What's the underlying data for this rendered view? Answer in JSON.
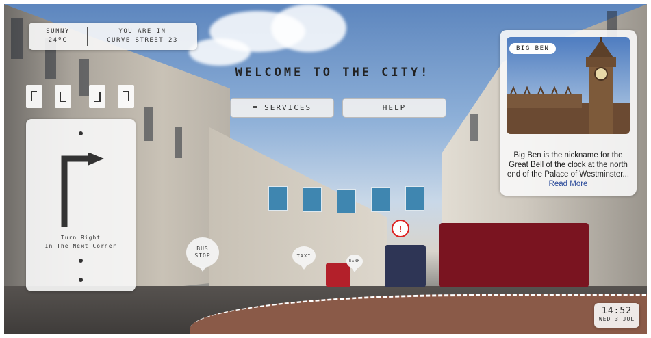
{
  "weather": {
    "condition": "SUNNY",
    "temperature": "24ºC"
  },
  "location": {
    "line1": "YOU ARE IN",
    "line2": "CURVE STREET 23"
  },
  "welcome_title": "WELCOME TO THE CITY!",
  "menu": {
    "services_icon": "≡",
    "services_label": "SERVICES",
    "help_label": "HELP"
  },
  "navigation": {
    "line1": "Turn Right",
    "line2": "In The Next Corner",
    "arrow_icon": "turn-right-arrow-icon"
  },
  "info_card": {
    "tag": "BIG BEN",
    "description": "Big Ben is the nickname for the Great Bell of the clock at the north end of the Palace of Westminster...",
    "read_more": "Read More"
  },
  "map_pins": {
    "bus_line1": "BUS",
    "bus_line2": "STOP",
    "taxi": "TAXI",
    "bank": "BANK",
    "alert": "!"
  },
  "clock": {
    "time": "14:52",
    "date": "WED 3 JUL"
  },
  "colors": {
    "panel": "#f8f8f8",
    "alert": "#d22222",
    "path": "#8a5a48",
    "link": "#2a4a9a"
  }
}
